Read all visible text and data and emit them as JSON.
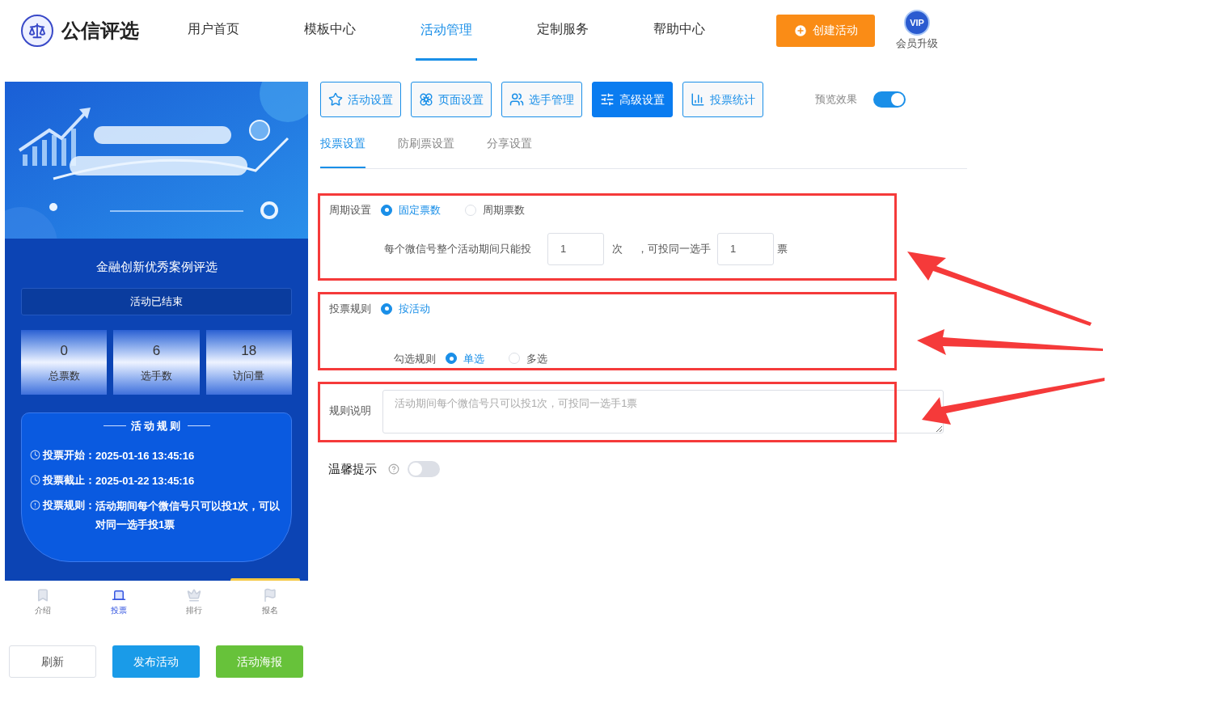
{
  "brand": {
    "name": "公信评选"
  },
  "nav": [
    {
      "label": "用户首页",
      "selected": false
    },
    {
      "label": "模板中心",
      "selected": false
    },
    {
      "label": "活动管理",
      "selected": true
    },
    {
      "label": "定制服务",
      "selected": false
    },
    {
      "label": "帮助中心",
      "selected": false
    }
  ],
  "create_button": "创建活动",
  "vip": {
    "badge": "VIP",
    "label": "会员升级"
  },
  "preview": {
    "title": "金融创新优秀案例评选",
    "status": "活动已结束",
    "stats": [
      {
        "value": "0",
        "label": "总票数"
      },
      {
        "value": "6",
        "label": "选手数"
      },
      {
        "value": "18",
        "label": "访问量"
      }
    ],
    "rules_title": "活动规则",
    "rules": [
      {
        "kind": "clock",
        "label": "投票开始：",
        "text": "2025-01-16 13:45:16"
      },
      {
        "kind": "clock",
        "label": "投票截止：",
        "text": "2025-01-22 13:45:16"
      },
      {
        "kind": "info",
        "label": "投票规则：",
        "text": "活动期间每个微信号只可以投1次，可以对同一选手投1票"
      }
    ],
    "tabs": [
      {
        "label": "介绍",
        "kind": "bookmark",
        "selected": false
      },
      {
        "label": "投票",
        "kind": "vote",
        "selected": true
      },
      {
        "label": "排行",
        "kind": "crown",
        "selected": false
      },
      {
        "label": "报名",
        "kind": "flag",
        "selected": false
      }
    ]
  },
  "preview_buttons": [
    {
      "label": "刷新",
      "kind": "outline"
    },
    {
      "label": "发布活动",
      "kind": "blue"
    },
    {
      "label": "活动海报",
      "kind": "green"
    }
  ],
  "toolbar": [
    {
      "label": "活动设置",
      "kind": "star",
      "selected": false
    },
    {
      "label": "页面设置",
      "kind": "flower",
      "selected": false
    },
    {
      "label": "选手管理",
      "kind": "users",
      "selected": false
    },
    {
      "label": "高级设置",
      "kind": "sliders",
      "selected": true
    },
    {
      "label": "投票统计",
      "kind": "chart",
      "selected": false
    }
  ],
  "preview_toggle": {
    "label": "预览效果",
    "on": true
  },
  "subtabs": [
    {
      "label": "投票设置",
      "selected": true
    },
    {
      "label": "防刷票设置",
      "selected": false
    },
    {
      "label": "分享设置",
      "selected": false
    }
  ],
  "period": {
    "label": "周期设置",
    "options": [
      {
        "label": "固定票数",
        "selected": true
      },
      {
        "label": "周期票数",
        "selected": false
      }
    ],
    "sentence_before": "每个微信号整个活动期间只能投",
    "times_value": "1",
    "times_unit": "次",
    "sentence_middle": "，可投同一选手",
    "votes_value": "1",
    "votes_unit": "票"
  },
  "vote_rule": {
    "label": "投票规则",
    "options": [
      {
        "label": "按活动",
        "selected": true
      }
    ],
    "check_label": "勾选规则",
    "check_options": [
      {
        "label": "单选",
        "selected": true
      },
      {
        "label": "多选",
        "selected": false
      }
    ]
  },
  "rule_text": {
    "label": "规则说明",
    "placeholder": "活动期间每个微信号只可以投1次，可投同一选手1票"
  },
  "tip": {
    "label": "温馨提示",
    "on": false
  }
}
